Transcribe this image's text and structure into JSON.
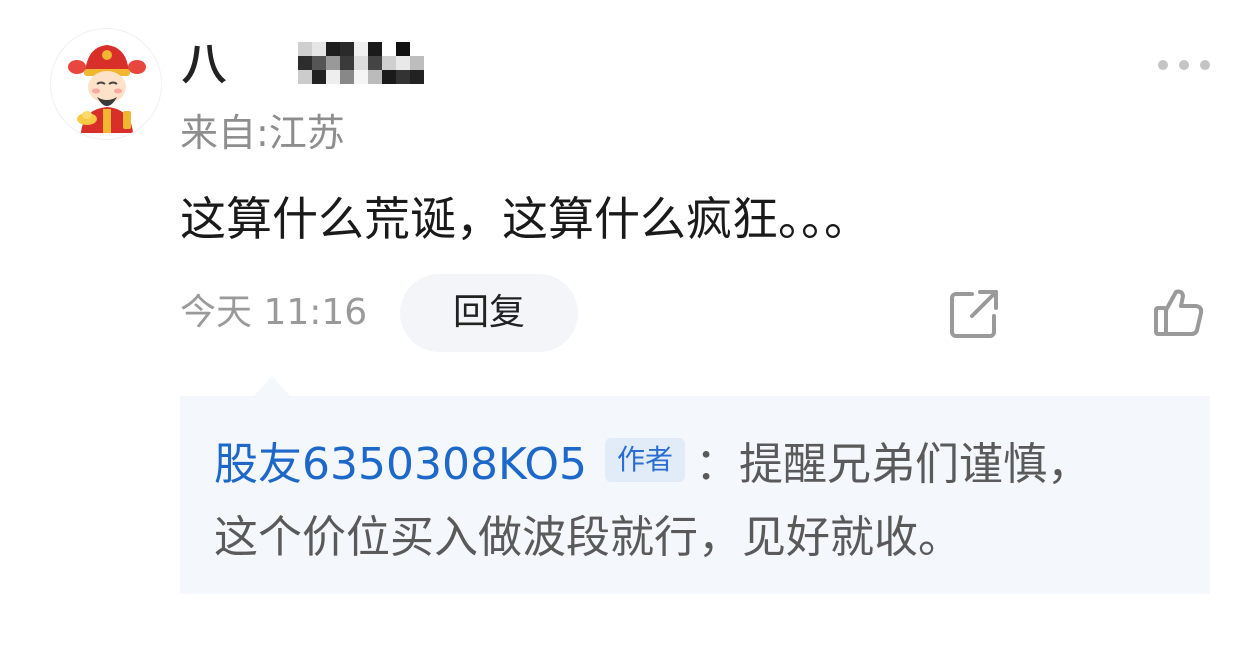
{
  "post": {
    "username_visible": "八",
    "location": "来自:江苏",
    "content": "这算什么荒诞，这算什么疯狂。。。",
    "time": "今天 11:16",
    "reply_label": "回复"
  },
  "icons": {
    "more": "more-dots-icon",
    "share": "share-icon",
    "like": "thumbs-up-icon",
    "avatar": "fortune-god-avatar"
  },
  "reply": {
    "user": "股友6350308KO5",
    "badge": "作者",
    "text_line1": "：提醒兄弟们谨慎，",
    "text_line2": "这个价位买入做波段就行，见好就收。"
  },
  "colors": {
    "link_blue": "#1d68c9",
    "badge_bg": "#e2ebf8",
    "reply_bg": "#f4f7fb",
    "muted_text": "#9a9a9a"
  }
}
